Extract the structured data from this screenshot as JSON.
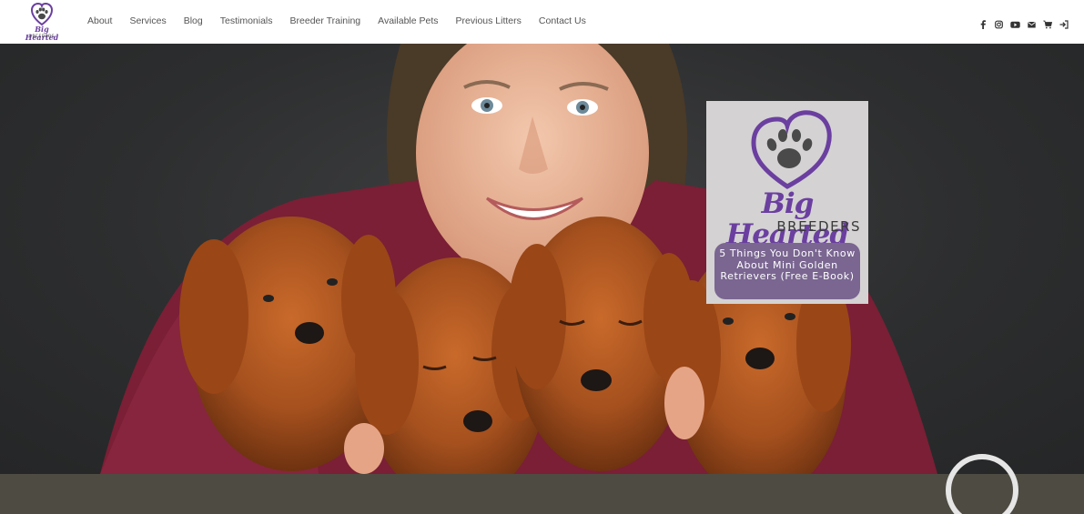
{
  "brand": {
    "script_name": "Big Hearted",
    "subtitle": "BREEDERS",
    "colors": {
      "purple": "#6b3fa0",
      "button_purple": "#7a6691",
      "paw_dark": "#4a4a4a"
    }
  },
  "nav": {
    "items": [
      "About",
      "Services",
      "Blog",
      "Testimonials",
      "Breeder Training",
      "Available Pets",
      "Previous Litters",
      "Contact Us"
    ]
  },
  "social": {
    "icons": [
      "facebook-icon",
      "instagram-icon",
      "youtube-icon",
      "email-icon",
      "cart-icon",
      "login-icon"
    ]
  },
  "promo": {
    "script_name": "Big Hearted",
    "subtitle": "BREEDERS",
    "button_label": "5 Things You Don't Know About Mini Golden Retrievers (Free E-Book)"
  },
  "band_color": "#4d4b42"
}
